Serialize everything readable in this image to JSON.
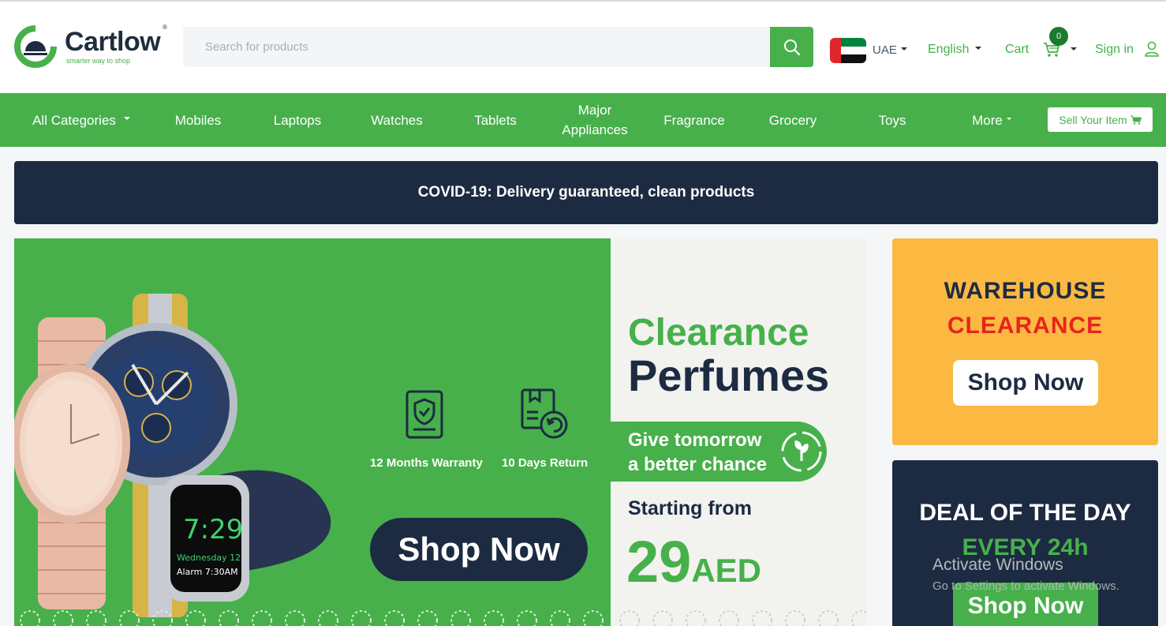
{
  "header": {
    "logo_text": "Cartlow",
    "logo_tagline": "smarter way to shop",
    "logo_reg": "®",
    "search_placeholder": "Search for products",
    "country": "UAE",
    "language": "English",
    "cart_label": "Cart",
    "cart_count": "0",
    "signin_label": "Sign in"
  },
  "nav": {
    "items": [
      {
        "label": "All Categories"
      },
      {
        "label": "Mobiles"
      },
      {
        "label": "Laptops"
      },
      {
        "label": "Watches"
      },
      {
        "label": "Tablets"
      },
      {
        "label": "Major Appliances"
      },
      {
        "label": "Fragrance"
      },
      {
        "label": "Grocery"
      },
      {
        "label": "Toys"
      },
      {
        "label": "More"
      }
    ],
    "sell_label": "Sell Your Item"
  },
  "notice": "COVID-19: Delivery guaranteed, clean products",
  "main_banner": {
    "feature_1": "12 Months Warranty",
    "feature_2": "10 Days Return",
    "shop_now": "Shop Now",
    "clearance": "Clearance",
    "perfumes": "Perfumes",
    "tagline_1": "Give tomorrow",
    "tagline_2": "a better chance",
    "starting_from": "Starting from",
    "price": "29",
    "currency": "AED",
    "watch_time": "7:29",
    "watch_date": "Wednesday 12",
    "watch_alarm": "Alarm 7:30AM"
  },
  "side_banners": [
    {
      "line1": "WAREHOUSE",
      "line2": "CLEARANCE",
      "button": "Shop Now"
    },
    {
      "line1": "DEAL OF THE DAY",
      "line2": "EVERY 24h",
      "button": "Shop Now"
    }
  ],
  "watermark": {
    "title": "Activate Windows",
    "subtitle": "Go to Settings to activate Windows."
  },
  "colors": {
    "brand_green": "#47b04b",
    "navy": "#1d2b42",
    "yellow": "#fbb942",
    "red": "#e8241e"
  },
  "icons": [
    "search-icon",
    "cart-icon",
    "user-icon",
    "shield-icon",
    "return-box-icon",
    "recycle-leaf-icon"
  ]
}
